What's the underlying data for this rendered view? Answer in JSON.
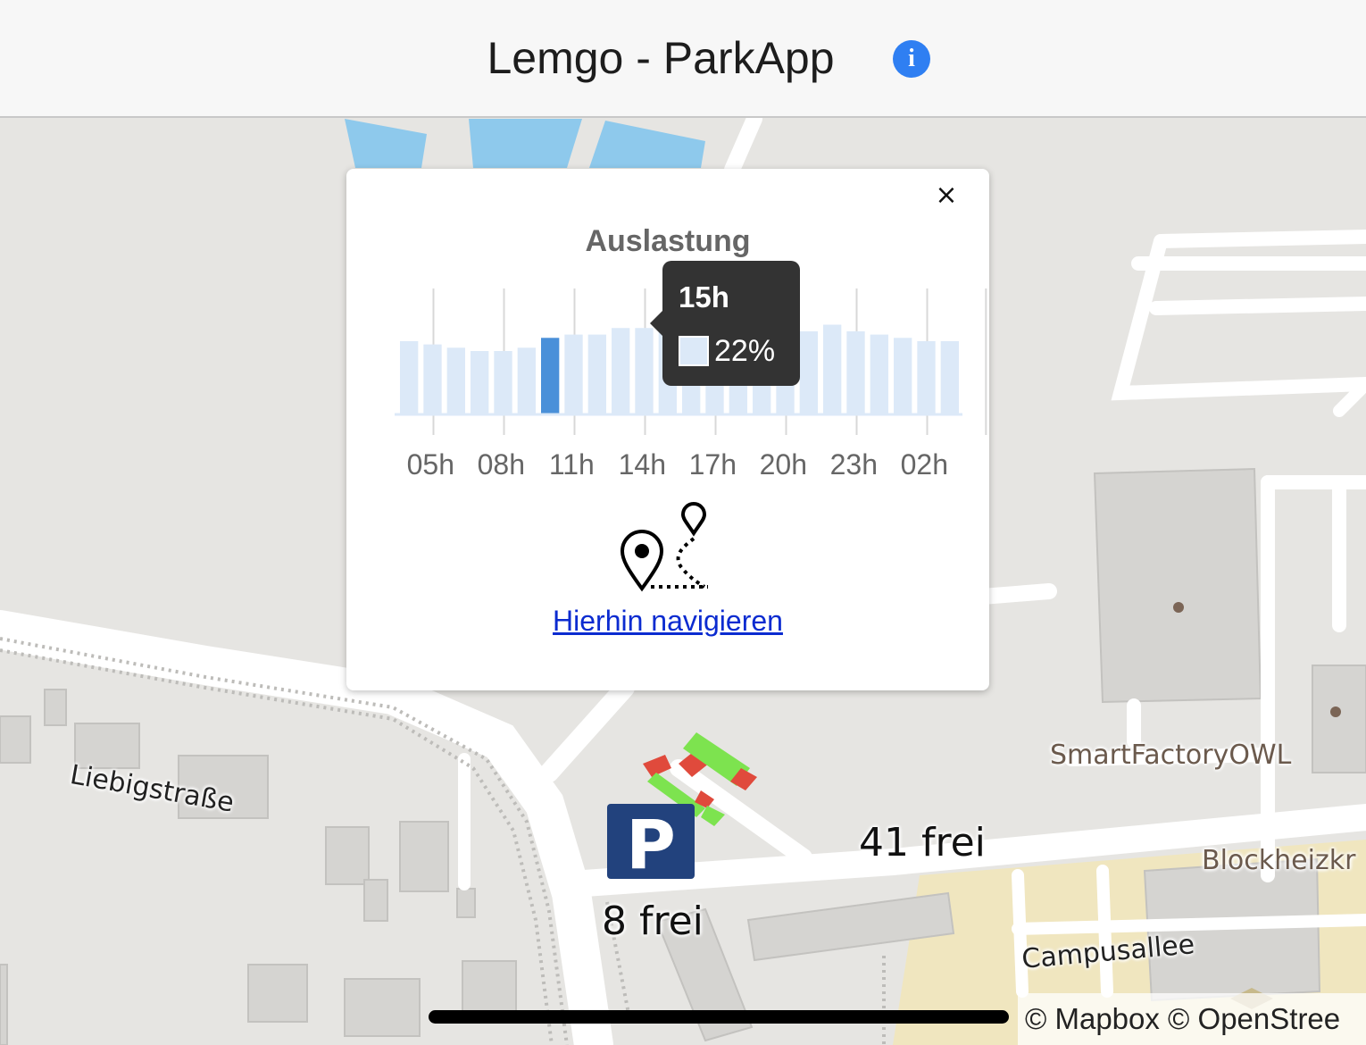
{
  "header": {
    "title": "Lemgo - ParkApp",
    "info_icon": "info-icon",
    "info_glyph": "i"
  },
  "map": {
    "labels": {
      "street_liebig": "Liebigstraße",
      "street_campus": "Campusallee",
      "poi_smartfactory": "SmartFactoryOWL",
      "poi_blockheiz": "Blockheizkr",
      "free_41": "41 frei",
      "free_8": "8 frei"
    },
    "parking_sign": "P",
    "attribution": "© Mapbox © OpenStree",
    "colors": {
      "free_spot": "#7de34f",
      "occupied_spot": "#e04a3c",
      "water": "#8ec9ec",
      "building": "#d5d4d1",
      "road": "#ffffff",
      "industrial": "#f0e6bf"
    }
  },
  "popup": {
    "close_label": "×",
    "chart_title": "Auslastung",
    "navigate_link": "Hierhin navigieren",
    "nav_icon": "route-pin-icon",
    "tooltip": {
      "title": "15h",
      "value": "22%"
    }
  },
  "chart_data": {
    "type": "bar",
    "title": "Auslastung",
    "tick_labels": [
      "05h",
      "08h",
      "11h",
      "14h",
      "17h",
      "20h",
      "23h",
      "02h"
    ],
    "categories": [
      "05h",
      "06h",
      "07h",
      "08h",
      "09h",
      "10h",
      "11h",
      "12h",
      "13h",
      "14h",
      "15h",
      "16h",
      "17h",
      "18h",
      "19h",
      "20h",
      "21h",
      "22h",
      "23h",
      "00h",
      "01h",
      "02h",
      "03h",
      "04h"
    ],
    "values": [
      22,
      21,
      20,
      19,
      19,
      20,
      23,
      24,
      24,
      26,
      26,
      27,
      26,
      26,
      26,
      26,
      26,
      25,
      27,
      25,
      24,
      23,
      22,
      22
    ],
    "highlight_index": 6,
    "colors": {
      "bar": "#dce9f8",
      "highlight": "#4a90d9",
      "grid": "#d8d8d8"
    },
    "grid": true,
    "ylim": [
      0,
      38
    ]
  }
}
